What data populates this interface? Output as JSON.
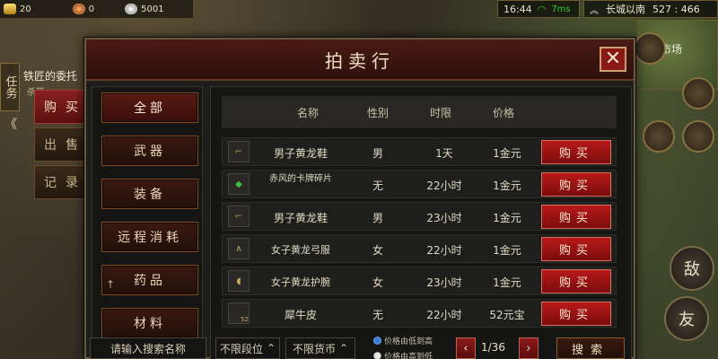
{
  "resources": {
    "gold": "20",
    "coupon": "0",
    "silver": "5001"
  },
  "status": {
    "time": "16:44",
    "ping": "7ms",
    "location": "长城以南",
    "coords": "527 : 466"
  },
  "quest": {
    "tab_label": "任务",
    "title": "铁匠的委托",
    "sub": "杀死"
  },
  "side_tabs": [
    "购买",
    "出售",
    "记录"
  ],
  "minimap_label": "市场",
  "auction": {
    "title": "拍卖行",
    "close_label": "✕",
    "categories": [
      "全部",
      "武器",
      "装备",
      "远程消耗",
      "药品",
      "材料"
    ],
    "columns": {
      "name": "名称",
      "sex": "性别",
      "time": "时限",
      "price": "价格"
    },
    "rows": [
      {
        "name": "男子黄龙鞋",
        "sex": "男",
        "time": "1天",
        "price": "1金元",
        "buy": "购买"
      },
      {
        "name": "赤风的卡牌碎片",
        "sex": "无",
        "time": "22小时",
        "price": "1金元",
        "buy": "购买"
      },
      {
        "name": "男子黄龙鞋",
        "sex": "男",
        "time": "23小时",
        "price": "1金元",
        "buy": "购买"
      },
      {
        "name": "女子黄龙弓服",
        "sex": "女",
        "time": "22小时",
        "price": "1金元",
        "buy": "购买"
      },
      {
        "name": "女子黄龙护腕",
        "sex": "女",
        "time": "23小时",
        "price": "1金元",
        "buy": "购买"
      },
      {
        "name": "犀牛皮",
        "sex": "无",
        "time": "22小时",
        "price": "52元宝",
        "buy": "购买"
      }
    ],
    "item_badge": "52"
  },
  "bottom": {
    "search_placeholder": "请输入搜索名称",
    "level_filter": "不限段位",
    "currency_filter": "不限货币",
    "sort_low": "价格由低到高",
    "sort_high": "价格由高到低",
    "page": "1/36",
    "search_button": "搜索"
  },
  "right_ctrl": {
    "enemy": "敌",
    "friend": "友"
  }
}
